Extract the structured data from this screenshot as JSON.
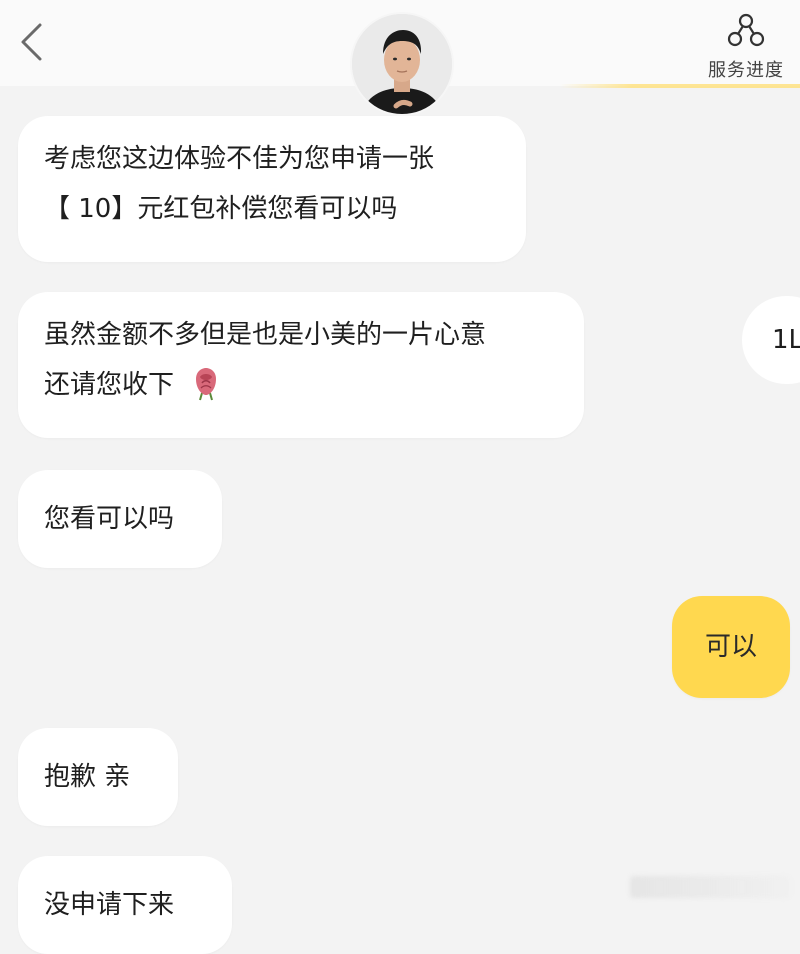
{
  "header": {
    "back_icon": "chevron-left-icon",
    "service_progress_icon": "network-nodes-icon",
    "service_progress_label": "服务进度",
    "accent_color": "#ffd84f"
  },
  "messages": [
    {
      "side": "agent",
      "line1": "考虑您这边体验不佳为您申请一张",
      "line2": "【 10】元红包补偿您看可以吗"
    },
    {
      "side": "agent",
      "line1": "虽然金额不多但是也是小美的一片心意",
      "line2": "还请您收下",
      "emoji": "rose-icon"
    },
    {
      "side": "agent",
      "text": "您看可以吗"
    },
    {
      "side": "user",
      "text": "可以"
    },
    {
      "side": "agent",
      "text": "抱歉 亲"
    },
    {
      "side": "agent",
      "text": "没申请下来"
    }
  ],
  "peek_message": {
    "side": "user",
    "text": "1L"
  }
}
